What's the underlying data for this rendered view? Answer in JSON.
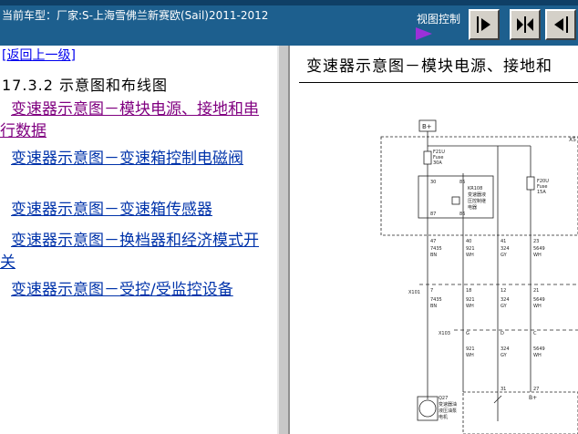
{
  "header": {
    "model_label": "当前车型：厂家:S-上海雪佛兰新赛欧(Sail)2011-2012",
    "view_control_label": "视图控制"
  },
  "nav": {
    "back_link": "[返回上一级]",
    "section_title": "17.3.2 示意图和布线图",
    "items": [
      {
        "label": "变速器示意图－模块电源、接地和串行数据"
      },
      {
        "label": "变速器示意图－变速箱控制电磁阀"
      },
      {
        "label": "变速器示意图－变速箱传感器"
      },
      {
        "label": "变速器示意图－换档器和经济模式开关"
      },
      {
        "label": "变速器示意图－受控/受监控设备"
      }
    ]
  },
  "content": {
    "title": "变速器示意图－模块电源、接地和",
    "diagram": {
      "bplus_top": "B+",
      "x_top": "X5",
      "f21u": "F21U",
      "f21u_fuse": "Fuse",
      "f21u_amp": "30A",
      "f20u": "F20U",
      "f20u_fuse": "Fuse",
      "f20u_amp": "15A",
      "kr108": "KR108",
      "kr108_desc1": "变速器液",
      "kr108_desc2": "压控制继",
      "kr108_desc3": "电器",
      "pin30": "30",
      "pin85": "85",
      "pin87": "87",
      "pin86": "86",
      "w1_pin": "47",
      "w1_num": "7435",
      "w1_color": "BN",
      "w2_pin": "40",
      "w2_num": "921",
      "w2_color": "WH",
      "w3_pin": "41",
      "w3_num": "324",
      "w3_color": "GY",
      "w4_pin": "23",
      "w4_num": "5649",
      "w4_color": "WH",
      "x101": "X101",
      "x101_p1": "7",
      "x101_p2": "18",
      "x101_p3": "12",
      "x101_p4": "21",
      "m1_num": "7435",
      "m1_color": "BN",
      "m2_num": "921",
      "m2_color": "WH",
      "m3_num": "324",
      "m3_color": "GY",
      "m4_num": "5649",
      "m4_color": "WH",
      "x103": "X103",
      "x103_g": "G",
      "x103_d": "D",
      "x103_c": "C",
      "l2_num": "921",
      "l2_color": "WH",
      "l3_num": "324",
      "l3_color": "GY",
      "l4_num": "5649",
      "l4_color": "WH",
      "p31": "31",
      "p27": "27",
      "bplus_bottom": "B+",
      "q27": "Q27",
      "q27_desc1": "变速器油",
      "q27_desc2": "液压油泵",
      "q27_desc3": "电机"
    }
  },
  "colors": {
    "header_bg": "#1d5f8e",
    "link": "#0033aa",
    "visited_link": "#800080",
    "arrow_purple": "#9b30d9"
  }
}
